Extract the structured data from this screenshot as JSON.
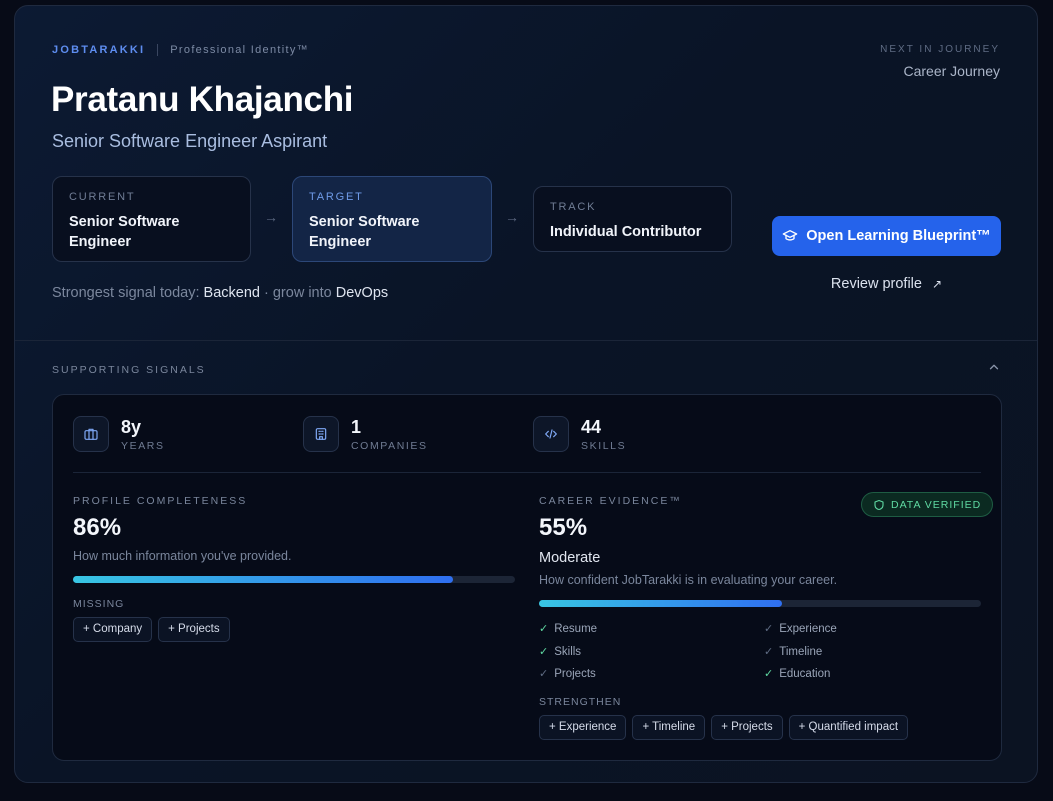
{
  "header": {
    "brand": "JOBTARAKKI",
    "identity": "Professional Identity™",
    "next_label": "NEXT IN JOURNEY",
    "next_value": "Career Journey",
    "name": "Pratanu Khajanchi",
    "role": "Senior Software Engineer Aspirant"
  },
  "path": {
    "current": {
      "label": "CURRENT",
      "value": "Senior Software Engineer"
    },
    "target": {
      "label": "TARGET",
      "value": "Senior Software Engineer"
    },
    "track": {
      "label": "TRACK",
      "value": "Individual Contributor"
    }
  },
  "signal": {
    "prefix": "Strongest signal today:",
    "strong": "Backend",
    "middle": "· grow into",
    "grow": "DevOps"
  },
  "actions": {
    "primary": "Open Learning Blueprint™",
    "secondary": "Review profile"
  },
  "supporting": {
    "label": "SUPPORTING SIGNALS",
    "stats": [
      {
        "value": "8y",
        "unit": "YEARS",
        "icon": "briefcase-icon"
      },
      {
        "value": "1",
        "unit": "COMPANIES",
        "icon": "building-icon"
      },
      {
        "value": "44",
        "unit": "SKILLS",
        "icon": "code-icon"
      }
    ]
  },
  "completeness": {
    "label": "PROFILE COMPLETENESS",
    "percent": "86%",
    "fraction": 0.86,
    "desc": "How much information you've provided.",
    "missing_label": "MISSING",
    "missing": [
      "+ Company",
      "+ Projects"
    ]
  },
  "evidence": {
    "label": "CAREER EVIDENCE™",
    "badge": "DATA VERIFIED",
    "percent": "55%",
    "fraction": 0.55,
    "level": "Moderate",
    "desc": "How confident JobTarakki is in evaluating your career.",
    "checks": [
      {
        "label": "Resume",
        "done": true
      },
      {
        "label": "Experience",
        "done": false
      },
      {
        "label": "Skills",
        "done": true
      },
      {
        "label": "Timeline",
        "done": false
      },
      {
        "label": "Projects",
        "done": false
      },
      {
        "label": "Education",
        "done": true
      }
    ],
    "strengthen_label": "STRENGTHEN",
    "strengthen": [
      "+ Experience",
      "+ Timeline",
      "+ Projects",
      "+ Quantified impact"
    ]
  },
  "colors": {
    "accent": "#2563eb",
    "verified": "#5fd9a2",
    "check_done": "#5fd9a2",
    "check_pending": "#5f6c84"
  }
}
